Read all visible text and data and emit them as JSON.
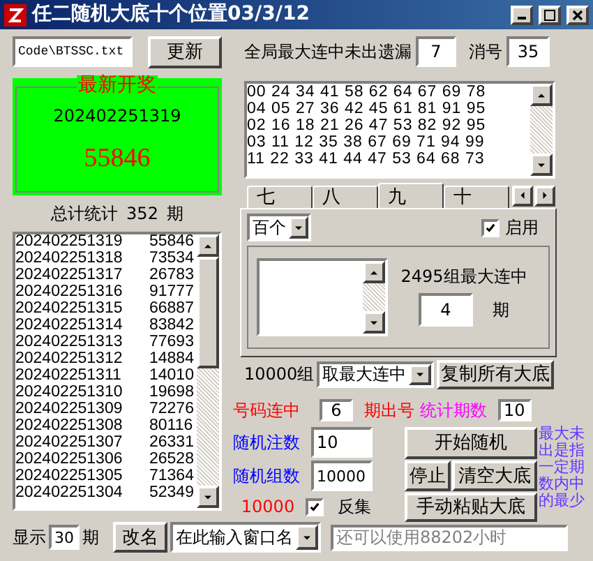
{
  "window": {
    "title": "任二随机大底十个位置03/3/12"
  },
  "file_field": {
    "value": "Code\\BTSSC.txt"
  },
  "refresh_button": "更新",
  "max_miss": {
    "label": "全局最大连中未出遗漏",
    "value": "7"
  },
  "eliminate": {
    "label": "消号",
    "value": "35"
  },
  "latest_draw": {
    "title": "最新开奖",
    "period": "202402251319",
    "number": "55846"
  },
  "total": {
    "label": "总计统计",
    "count": "352",
    "unit": "期"
  },
  "history": [
    {
      "period": "202402251319",
      "number": "55846"
    },
    {
      "period": "202402251318",
      "number": "73534"
    },
    {
      "period": "202402251317",
      "number": "26783"
    },
    {
      "period": "202402251316",
      "number": "91777"
    },
    {
      "period": "202402251315",
      "number": "66887"
    },
    {
      "period": "202402251314",
      "number": "83842"
    },
    {
      "period": "202402251313",
      "number": "77693"
    },
    {
      "period": "202402251312",
      "number": "14884"
    },
    {
      "period": "202402251311",
      "number": "14010"
    },
    {
      "period": "202402251310",
      "number": "19698"
    },
    {
      "period": "202402251309",
      "number": "72276"
    },
    {
      "period": "202402251308",
      "number": "80116"
    },
    {
      "period": "202402251307",
      "number": "26331"
    },
    {
      "period": "202402251306",
      "number": "26528"
    },
    {
      "period": "202402251305",
      "number": "71364"
    },
    {
      "period": "202402251304",
      "number": "52349"
    }
  ],
  "number_groups": [
    "00 24 34 41 58 62 64 67 69 78",
    "04 05 27 36 42 45 61 81 91 95",
    "02 16 18 21 26 47 53 82 92 95",
    "03 11 12 35 38 67 69 71 94 99",
    "11 22 33 41 44 47 53 64 68 73"
  ],
  "tabs": [
    {
      "label": "七",
      "selected": false
    },
    {
      "label": "八",
      "selected": false
    },
    {
      "label": "九",
      "selected": true
    },
    {
      "label": "十",
      "selected": false
    }
  ],
  "tab_panel": {
    "position_select": "百个",
    "enabled": {
      "label": "启用",
      "checked": true
    },
    "stat_text": "2495组最大连中",
    "streak": "4",
    "unit": "期"
  },
  "group_row": {
    "label": "10000组",
    "mode_select": "取最大连中",
    "copy_button": "复制所有大底"
  },
  "streak_row": {
    "label": "号码连中",
    "value": "6",
    "label2": "期出号",
    "stats_label": "统计期数",
    "stats_value": "10"
  },
  "random_count": {
    "label": "随机注数",
    "value": "10"
  },
  "random_groups": {
    "label": "随机组数",
    "value": "10000"
  },
  "buttons": {
    "start": "开始随机",
    "stop": "停止",
    "clear": "清空大底",
    "paste": "手动粘贴大底"
  },
  "result_count": "10000",
  "invert": {
    "label": "反集",
    "checked": true
  },
  "note": "最大未出是指一定期数内中的最少",
  "bottom": {
    "show_label": "显示",
    "show_value": "30",
    "show_unit": "期",
    "rename_button": "改名",
    "window_name_select": "在此输入窗口名",
    "remaining": {
      "value": "还可以使用88202小时",
      "disabled": true
    }
  }
}
